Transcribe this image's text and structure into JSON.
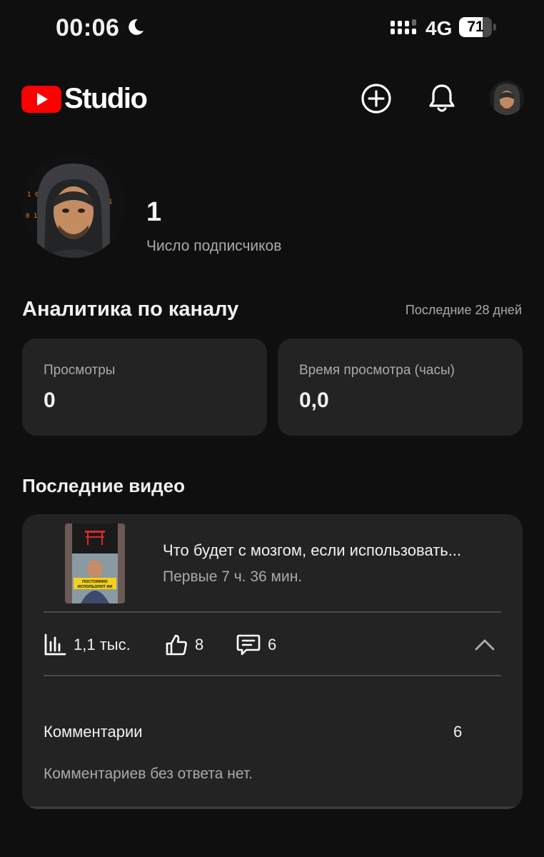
{
  "status_bar": {
    "time": "00:06",
    "network": "4G",
    "battery": "71",
    "battery_level": 0.71,
    "icons": [
      "moon-icon",
      "signal-icon",
      "battery-icon"
    ]
  },
  "header": {
    "logo_text": "Studio",
    "icons": [
      "youtube-logo-icon",
      "create-icon",
      "bell-icon",
      "avatar-icon"
    ],
    "colors": {
      "youtube_red": "#ff0000"
    }
  },
  "channel": {
    "subscribers": "1",
    "subscribers_label": "Число подписчиков"
  },
  "analytics": {
    "title": "Аналитика по каналу",
    "period": "Последние 28 дней",
    "cards": [
      {
        "label": "Просмотры",
        "value": "0"
      },
      {
        "label": "Время просмотра (часы)",
        "value": "0,0"
      }
    ]
  },
  "recent_videos": {
    "title": "Последние видео",
    "video": {
      "title": "Что будет с мозгом, если использовать...",
      "meta": "Первые 7 ч. 36 мин.",
      "views": "1,1 тыс.",
      "likes": "8",
      "comments": "6",
      "thumbnail_caption": "ПОСТОЯННО ИСПОЛЬЗУЮТ ИИ",
      "comments_section": {
        "label": "Комментарии",
        "count": "6",
        "note": "Комментариев без ответа нет."
      }
    }
  }
}
